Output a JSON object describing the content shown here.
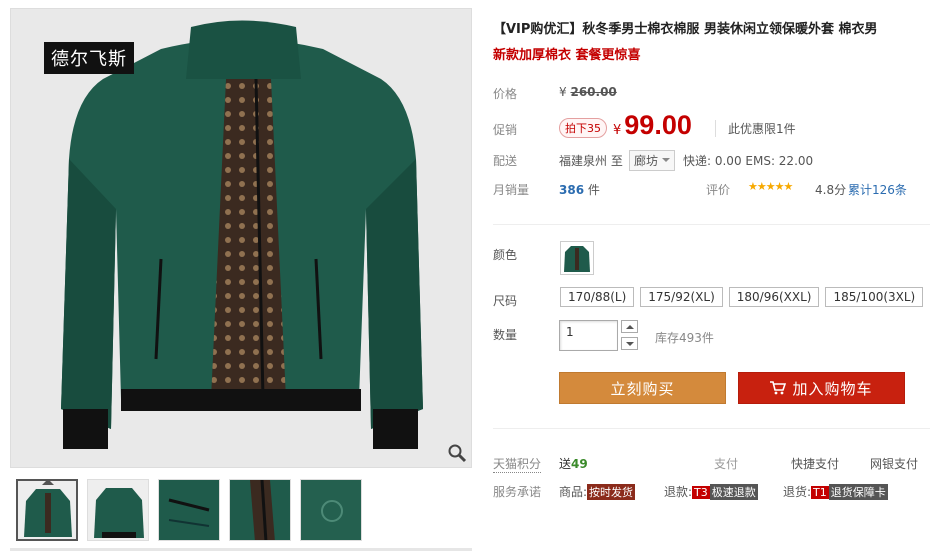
{
  "gallery": {
    "brand_tag": "德尔飞斯",
    "thumbnails": 5
  },
  "product": {
    "title": "【VIP购优汇】秋冬季男士棉衣棉服 男装休闲立领保暖外套 棉衣男",
    "subtitle": "新款加厚棉衣 套餐更惊喜"
  },
  "price": {
    "label": "价格",
    "currency": "¥",
    "original": "260.00"
  },
  "promo": {
    "label": "促销",
    "badge": "拍下35",
    "currency": "¥",
    "price": "99.00",
    "note": "此优惠限1件"
  },
  "shipping": {
    "label": "配送",
    "from": "福建泉州",
    "to_word": "至",
    "destination": "廊坊",
    "cost": "快递: 0.00 EMS: 22.00"
  },
  "sales": {
    "label": "月销量",
    "count": "386",
    "unit": "件",
    "rating_label": "评价",
    "stars": "★★★★★",
    "score": "4.8分",
    "reviews": "累计126条"
  },
  "options": {
    "color_label": "颜色",
    "size_label": "尺码",
    "sizes": [
      "170/88(L)",
      "175/92(XL)",
      "180/96(XXL)",
      "185/100(3XL)"
    ],
    "qty_label": "数量",
    "qty_value": "1",
    "stock": "库存493件"
  },
  "actions": {
    "buy": "立刻购买",
    "cart": "加入购物车"
  },
  "points": {
    "label": "天猫积分",
    "give": "送",
    "value": "49",
    "pay1": "支付",
    "pay2": "快捷支付",
    "pay3": "网银支付"
  },
  "service": {
    "label": "服务承诺",
    "goods_label": "商品:",
    "goods_tag": "按时发货",
    "refund_label": "退款:",
    "refund_code": "T3",
    "refund_tag": "极速退款",
    "return_label": "退货:",
    "return_code": "T1",
    "return_tag": "退货保障卡"
  },
  "colors": {
    "price_red": "#c40000",
    "buy_button": "#d48a3c",
    "cart_button": "#c8210f",
    "link_blue": "#2b6cb0",
    "star": "#f7a900",
    "jacket_green": "#1f5b4b"
  }
}
